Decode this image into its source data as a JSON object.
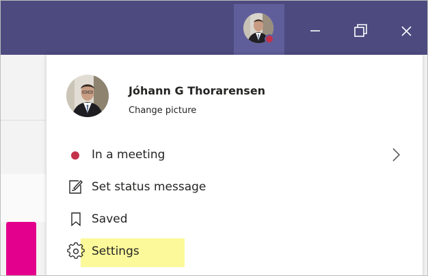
{
  "profile": {
    "name": "Jóhann G Thorarensen",
    "change_picture": "Change picture",
    "avatar_icon": "user-photo"
  },
  "menu": {
    "status": {
      "label": "In a meeting",
      "dot_color": "#c4314b"
    },
    "set_status_message": {
      "label": "Set status message",
      "icon": "edit-note-icon"
    },
    "saved": {
      "label": "Saved",
      "icon": "bookmark-icon"
    },
    "settings": {
      "label": "Settings",
      "icon": "gear-icon"
    }
  },
  "window_controls": [
    "minimize-icon",
    "restore-icon",
    "close-icon"
  ],
  "colors": {
    "titlebar": "#4c4a7f",
    "avatar_button": "#605e9a",
    "presence": "#c4314b",
    "highlight": "#fcf99a",
    "accent_left": "#e3008c"
  }
}
